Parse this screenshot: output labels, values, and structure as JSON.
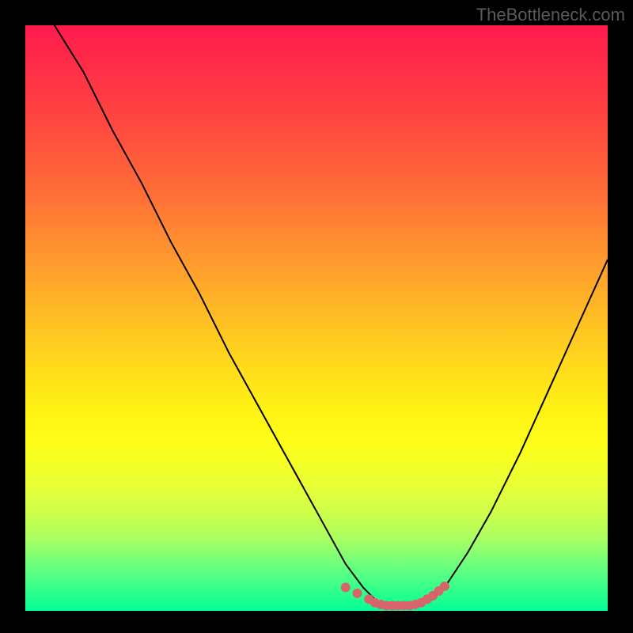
{
  "watermark": "TheBottleneck.com",
  "chart_data": {
    "type": "line",
    "title": "",
    "xlabel": "",
    "ylabel": "",
    "xlim": [
      0,
      100
    ],
    "ylim": [
      0,
      100
    ],
    "series": [
      {
        "name": "curve",
        "x": [
          5,
          10,
          15,
          20,
          25,
          30,
          35,
          40,
          45,
          50,
          55,
          58,
          60,
          62,
          66,
          68,
          70,
          72,
          76,
          80,
          85,
          90,
          95,
          100
        ],
        "y": [
          100,
          92,
          82,
          73,
          63,
          54,
          44,
          35,
          26,
          17,
          8,
          4,
          2,
          1,
          1,
          1,
          2,
          4,
          10,
          17,
          27,
          38,
          49,
          60
        ]
      }
    ],
    "flat_markers": {
      "name": "flat-region",
      "x": [
        55,
        57,
        59,
        60,
        61,
        62,
        63,
        64,
        65,
        66,
        67,
        68,
        69,
        70,
        71,
        72
      ],
      "y": [
        4,
        3,
        2,
        1.4,
        1.1,
        0.9,
        0.9,
        0.9,
        0.9,
        0.9,
        1.1,
        1.4,
        2,
        2.6,
        3.4,
        4.2
      ]
    },
    "colors": {
      "curve": "#000000",
      "marker": "#d9636a",
      "gradient_top": "#ff1a4d",
      "gradient_bottom": "#00ffa0"
    }
  }
}
